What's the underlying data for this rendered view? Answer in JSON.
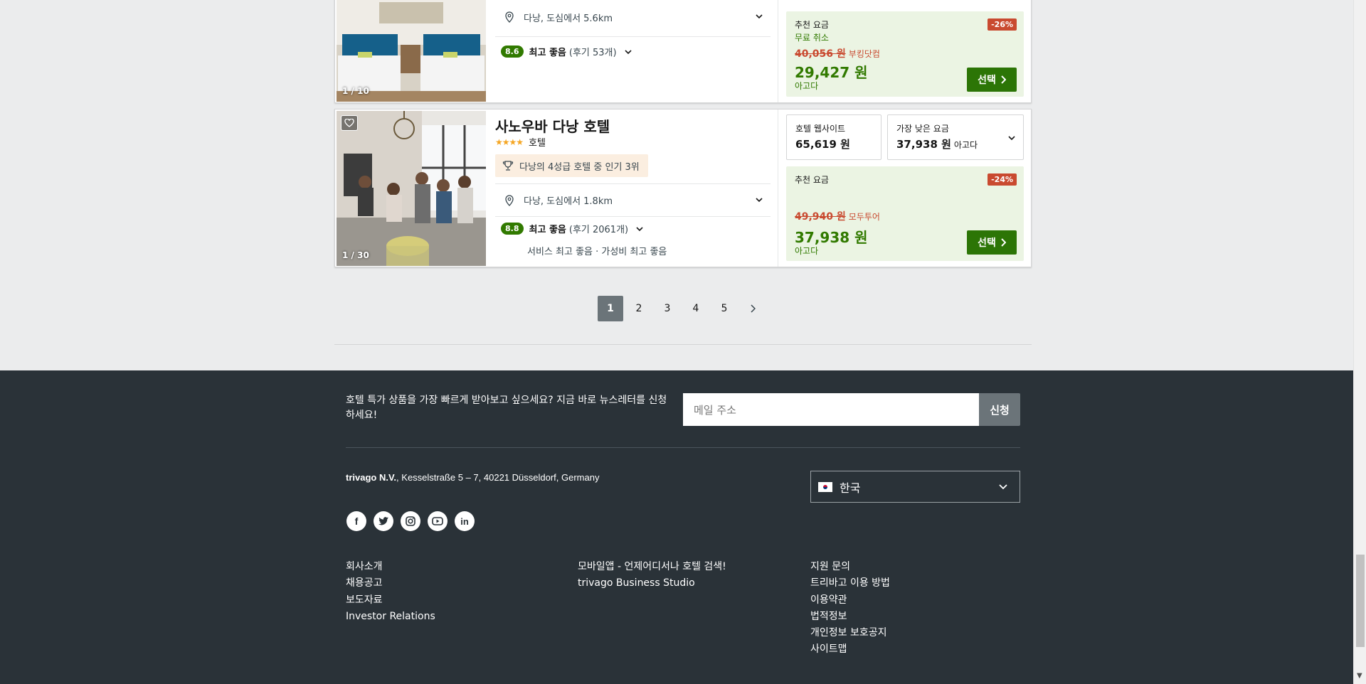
{
  "hotels": [
    {
      "img_counter": "1 / 10",
      "location": "다낭, 도심에서 5.6km",
      "score": "8.6",
      "rating_label": "최고 좋음",
      "reviews": "(후기 53개)",
      "deal": {
        "label": "추천 요금",
        "free_cancel": "무료 취소",
        "discount": "-26%",
        "old_price": "40,056 원",
        "old_source": "부킹닷컴",
        "price": "29,427 원",
        "source": "아고다",
        "select": "선택"
      }
    },
    {
      "img_counter": "1 / 30",
      "name": "사노우바 다낭 호텔",
      "stars_label": "호텔",
      "rank_badge": "다낭의 4성급 호텔 중 인기 3위",
      "location": "다낭, 도심에서 1.8km",
      "score": "8.8",
      "rating_label": "최고 좋음",
      "reviews": "(후기 2061개)",
      "highlights": "서비스 최고 좋음 · 가성비 최고 좋음",
      "website_label": "호텔 웹사이트",
      "website_price": "65,619 원",
      "lowest_label": "가장 낮은 요금",
      "lowest_price": "37,938 원",
      "lowest_source": "아고다",
      "deal": {
        "label": "추천 요금",
        "discount": "-24%",
        "old_price": "49,940 원",
        "old_source": "모두투어",
        "price": "37,938 원",
        "source": "아고다",
        "select": "선택"
      }
    }
  ],
  "pagination": {
    "pages": [
      "1",
      "2",
      "3",
      "4",
      "5"
    ],
    "active": "1"
  },
  "footer": {
    "newsletter_text": "호텔 특가 상품을 가장 빠르게 받아보고 싶으세요? 지금 바로 뉴스레터를 신청하세요!",
    "email_placeholder": "메일 주소",
    "subscribe": "신청",
    "company": "trivago N.V.",
    "address": ", Kesselstraße 5 – 7, 40221 Düsseldorf, Germany",
    "country": "한국",
    "col1": [
      "회사소개",
      "채용공고",
      "보도자료",
      "Investor Relations"
    ],
    "col2": [
      "모바일앱 - 언제어디서나 호텔 검색!",
      "trivago Business Studio"
    ],
    "col3": [
      "지원 문의",
      "트리바고 이용 방법",
      "이용약관",
      "법적정보",
      "개인정보 보호공지",
      "사이트맵"
    ]
  },
  "colors": {
    "accent_green": "#2c7506",
    "discount_red": "#c94a30",
    "footer_bg": "#2a3238"
  }
}
